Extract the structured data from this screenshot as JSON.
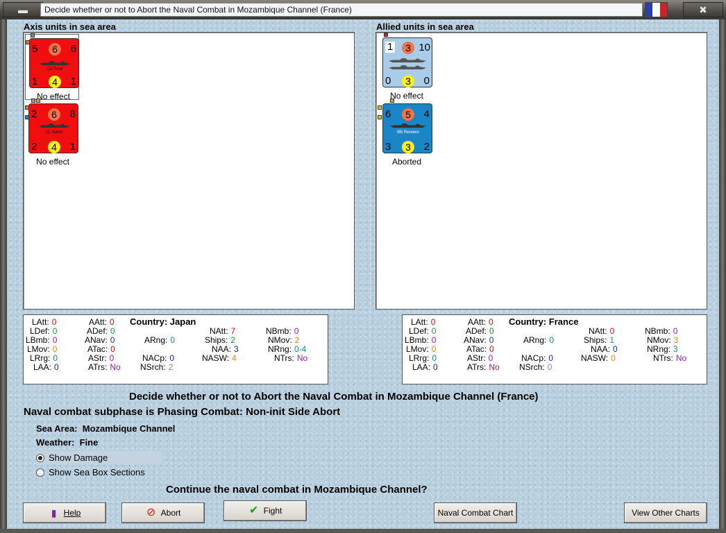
{
  "window": {
    "title": "Decide whether or not to Abort the Naval Combat in Mozambique Channel (France)",
    "minimize_icon": "window-minimize-icon",
    "close_icon": "close-icon",
    "flag_colors": [
      "#2a3fa8",
      "#ffffff",
      "#d0202a"
    ]
  },
  "axis_panel": {
    "title": "Axis units in sea area",
    "units": [
      {
        "name": "CA Tone",
        "color": "#f00e0e",
        "top_left": "5",
        "top_mid": "6",
        "top_right": "6",
        "bottom_left": "1",
        "bottom_mid": "4",
        "bottom_right": "1",
        "status": "No effect"
      },
      {
        "name": "CL Natori",
        "color": "#f00e0e",
        "top_left": "2",
        "top_mid": "6",
        "top_right": "8",
        "bottom_left": "2",
        "bottom_mid": "4",
        "bottom_right": "1",
        "status": "No effect"
      }
    ]
  },
  "allied_panel": {
    "title": "Allied units in sea area",
    "units": [
      {
        "name": "",
        "color": "#a9cde8",
        "top_left": "1",
        "top_mid": "3",
        "top_right": "10",
        "bottom_left": "0",
        "bottom_mid": "3",
        "bottom_right": "0",
        "status": "No effect"
      },
      {
        "name": "BB Renown",
        "color": "#1a86c6",
        "top_left": "6",
        "top_mid": "5",
        "top_right": "4",
        "bottom_left": "3",
        "bottom_mid": "3",
        "bottom_right": "2",
        "status": "Aborted"
      }
    ]
  },
  "axis_stats": {
    "country_label": "Country:",
    "country": "Japan",
    "LAtt": "0",
    "LDef": "0",
    "LBmb": "0",
    "LMov": "0",
    "LRrg": "0",
    "LAA": "0",
    "AAtt": "0",
    "ADef": "0",
    "ANav": "0",
    "ATac": "0",
    "AStr": "0",
    "ATrs": "No",
    "ARng": "0",
    "NACp": "0",
    "NSrch": "2",
    "NAtt": "7",
    "Ships": "2",
    "NAA": "3",
    "NASW": "4",
    "NBmb": "0",
    "NMov": "2",
    "NRng": "0-4",
    "NTrs": "No"
  },
  "allied_stats": {
    "country_label": "Country:",
    "country": "France",
    "LAtt": "0",
    "LDef": "0",
    "LBmb": "0",
    "LMov": "0",
    "LRrg": "0",
    "LAA": "0",
    "AAtt": "0",
    "ADef": "0",
    "ANav": "0",
    "ATac": "0",
    "AStr": "0",
    "ATrs": "No",
    "ARng": "0",
    "NACp": "0",
    "NSrch": "0",
    "NAtt": "0",
    "Ships": "1",
    "NAA": "0",
    "NASW": "0",
    "NBmb": "0",
    "NMov": "3",
    "NRng": "3",
    "NTrs": "No"
  },
  "main": {
    "heading": "Decide whether or not to Abort the Naval Combat in Mozambique Channel (France)",
    "subphase": "Naval combat subphase is Phasing Combat: Non-init Side Abort",
    "sea_area_label": "Sea Area:",
    "sea_area": "Mozambique Channel",
    "weather_label": "Weather:",
    "weather": "Fine",
    "show_damage": "Show Damage",
    "show_sea_box": "Show Sea Box Sections",
    "question": "Continue the naval combat in Mozambique Channel?"
  },
  "buttons": {
    "help": "Help",
    "abort": "Abort",
    "fight": "Fight",
    "naval_chart": "Naval Combat Chart",
    "other_charts": "View Other Charts"
  }
}
